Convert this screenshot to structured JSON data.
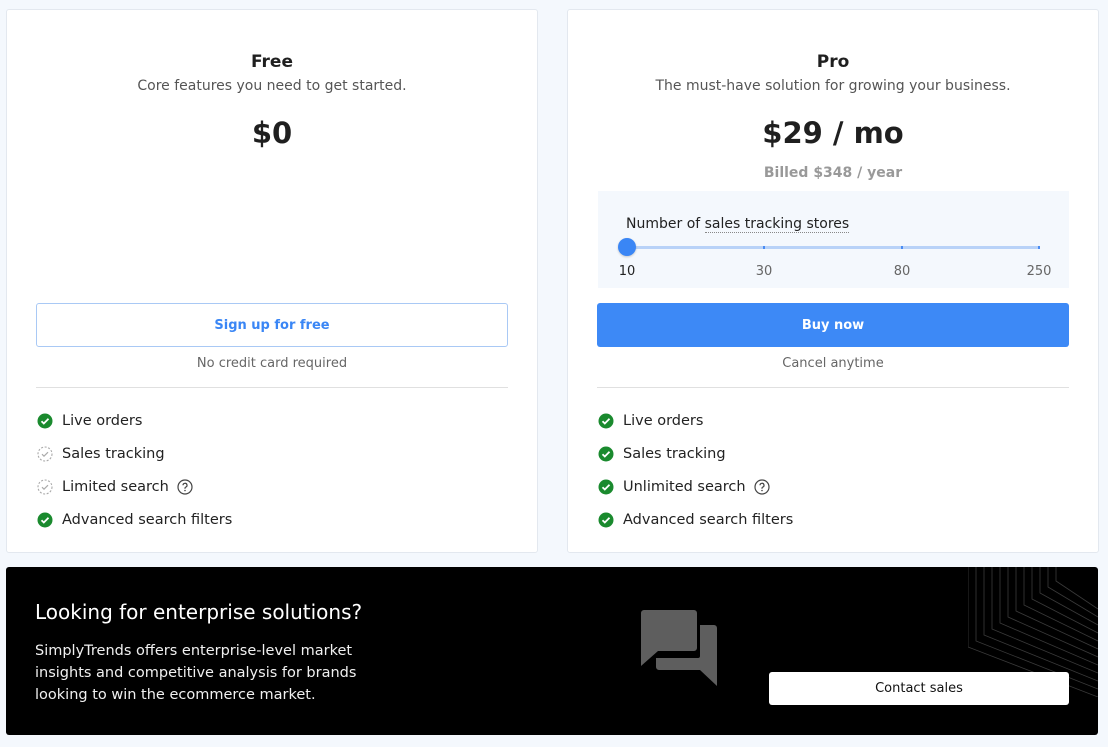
{
  "plans": {
    "free": {
      "title": "Free",
      "subtitle": "Core features you need to get started.",
      "price": "$0",
      "button_label": "Sign up for free",
      "button_note": "No credit card required",
      "features": [
        {
          "label": "Live orders",
          "status": "included"
        },
        {
          "label": "Sales tracking",
          "status": "partial"
        },
        {
          "label": "Limited search",
          "status": "partial",
          "help": true
        },
        {
          "label": "Advanced search filters",
          "status": "included"
        }
      ]
    },
    "pro": {
      "title": "Pro",
      "subtitle": "The must-have solution for growing your business.",
      "price": "$29 / mo",
      "billed": "Billed $348 / year",
      "slider": {
        "label_prefix": "Number of ",
        "label_term": "sales tracking stores",
        "options": [
          "10",
          "30",
          "80",
          "250"
        ],
        "selected": "10"
      },
      "button_label": "Buy now",
      "button_note": "Cancel anytime",
      "features": [
        {
          "label": "Live orders",
          "status": "included"
        },
        {
          "label": "Sales tracking",
          "status": "included"
        },
        {
          "label": "Unlimited search",
          "status": "included",
          "help": true
        },
        {
          "label": "Advanced search filters",
          "status": "included"
        }
      ]
    }
  },
  "enterprise": {
    "title": "Looking for enterprise solutions?",
    "description": "SimplyTrends offers enterprise-level market insights and competitive analysis for brands looking to win the ecommerce market.",
    "button_label": "Contact sales",
    "icon": "chat-bubbles-icon"
  },
  "colors": {
    "accent": "#3d89f6",
    "check": "#1a8a2e",
    "background": "#f4f8fd"
  }
}
